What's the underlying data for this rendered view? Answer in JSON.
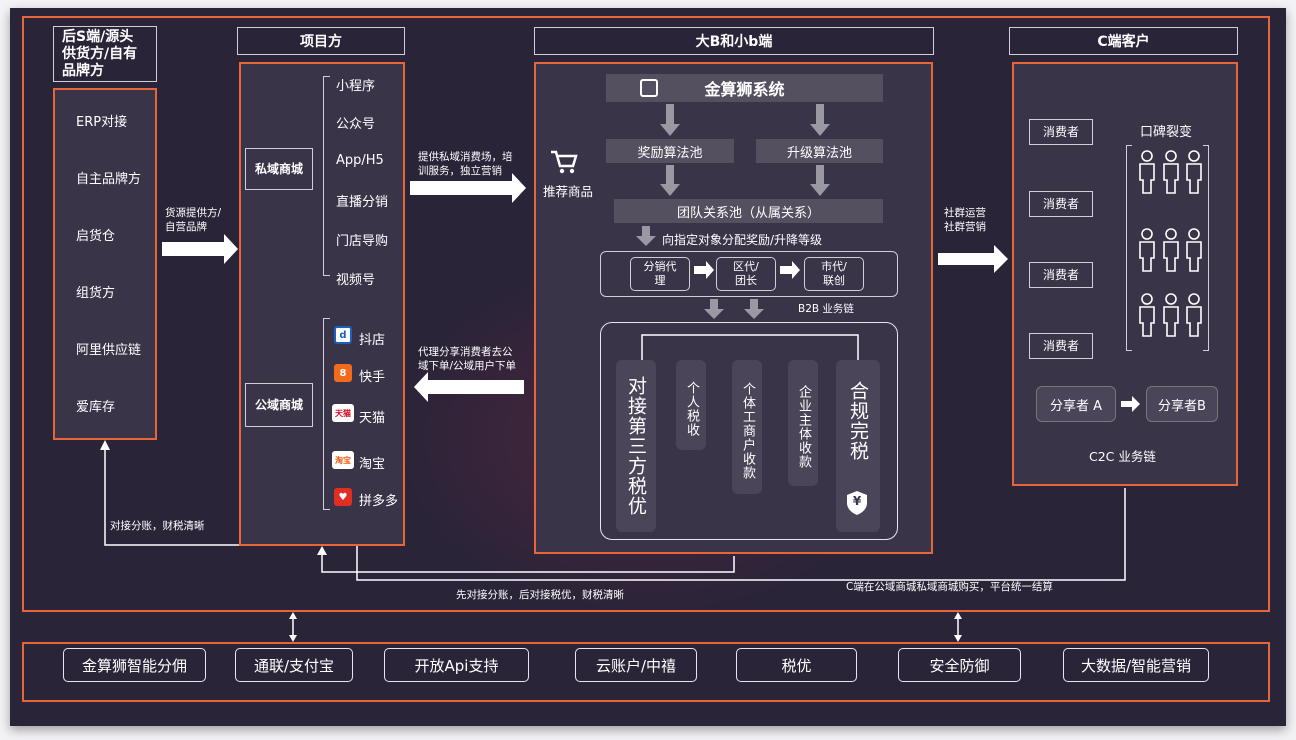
{
  "columns": {
    "supplier": {
      "header": "后S端/源头\n供货方/自有\n品牌方",
      "items": [
        "ERP对接",
        "自主品牌方",
        "启货仓",
        "组货方",
        "阿里供应链",
        "爱库存"
      ]
    },
    "project": {
      "header": "项目方",
      "private_label": "私域商城",
      "private_items": [
        "小程序",
        "公众号",
        "App/H5",
        "直播分销",
        "门店导购",
        "视频号"
      ],
      "public_label": "公域商城",
      "public_items": [
        "抖店",
        "快手",
        "天猫",
        "淘宝",
        "拼多多"
      ]
    },
    "business": {
      "header": "大B和小b端",
      "system_name": "金算狮系统",
      "reward_pool": "奖励算法池",
      "upgrade_pool": "升级算法池",
      "recommend": "推荐商品",
      "team_pool": "团队关系池（从属关系）",
      "assign_text": "向指定对象分配奖励/升降等级",
      "levels": [
        "分销代\n理",
        "区代/\n团长",
        "市代/\n联创"
      ],
      "b2b_label": "B2B 业务链",
      "tax_main": "对接第三方税优",
      "tax_items": [
        "个人税收",
        "个体工商户收款",
        "企业主体收款"
      ],
      "tax_compliance": "合规完税",
      "yen_icon": "¥"
    },
    "customer": {
      "header": "C端客户",
      "consumers": [
        "消费者",
        "消费者",
        "消费者",
        "消费者"
      ],
      "word_of_mouth": "口碑裂变",
      "sharer_a": "分享者 A",
      "sharer_b": "分享者B",
      "c2c_label": "C2C 业务链"
    }
  },
  "flows": {
    "supply_to_project": "货源提供方/\n自营品牌",
    "project_to_business": "提供私域消费场，培\n训服务，独立营销",
    "business_to_project": "代理分享消费者去公\n域下单/公域用户下单",
    "business_to_customer": "社群运营\n社群营销",
    "project_to_supplier": "对接分账，财税清晰",
    "bottom_split": "先对接分账，后对接税优，财税清晰",
    "customer_settlement": "C端在公域商城私域商城购买，平台统一结算"
  },
  "services": [
    "金算狮智能分佣",
    "通联/支付宝",
    "开放Api支持",
    "云账户/中禧",
    "税优",
    "安全防御",
    "大数据/智能营销"
  ],
  "colors": {
    "accent": "#e8643a",
    "panel": "#3a3448",
    "bg": "#2a2438"
  }
}
